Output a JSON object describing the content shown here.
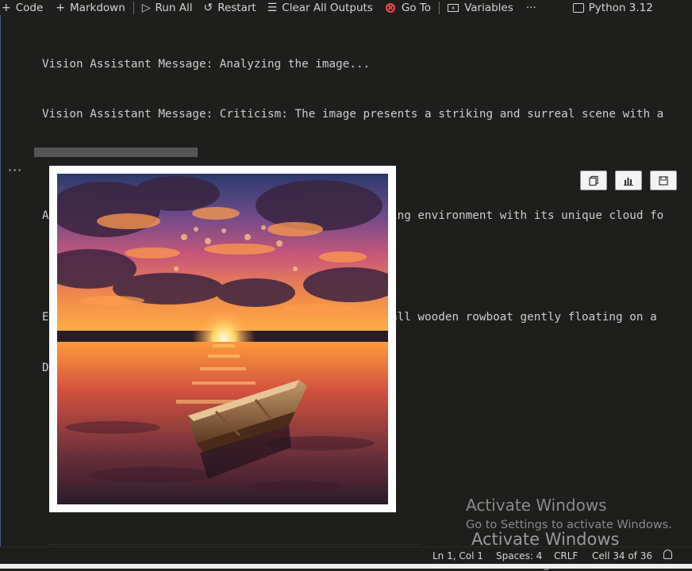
{
  "toolbar": {
    "code_label": "Code",
    "markdown_label": "Markdown",
    "run_all_label": "Run All",
    "restart_label": "Restart",
    "clear_outputs_label": "Clear All Outputs",
    "goto_label": "Go To",
    "variables_label": "Variables",
    "more_label": "···",
    "kernel_label": "Python 3.12"
  },
  "output": {
    "lines": [
      "Vision Assistant Message: Analyzing the image...",
      "Vision Assistant Message: Criticism: The image presents a striking and surreal scene with a",
      "",
      "Analysis: The image successfully creates a captivating environment with its unique cloud fo",
      "",
      "Enhanced Prompt for Dall-e: Create an image of a small wooden rowboat gently floating on a",
      "Dalle Assistant Message: Creating the image ..."
    ],
    "more_label": "···"
  },
  "output_buttons": {
    "copy_icon": "copy-icon",
    "chart_icon": "chart-icon",
    "save_icon": "save-icon"
  },
  "watermark": {
    "line1": "Activate Windows",
    "line2": "Go to Settings to activate Windows.",
    "line3": "Activate Windows",
    "line4": "Go to Settings to activate Windows."
  },
  "statusbar": {
    "position": "Ln 1, Col 1",
    "spaces": "Spaces: 4",
    "eol": "CRLF",
    "cell": "Cell 34 of 36"
  },
  "colors": {
    "background": "#1e1f1c",
    "goto_icon": "#f14c4c",
    "rail": "#3b5f8a"
  }
}
